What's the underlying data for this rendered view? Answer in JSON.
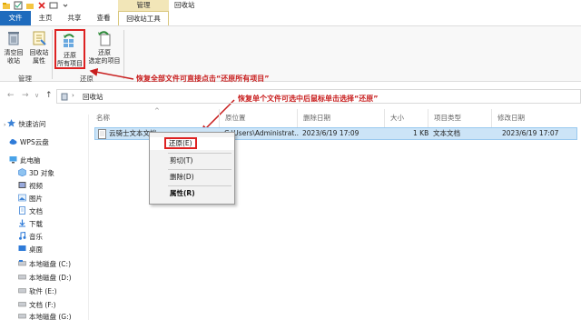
{
  "title_bar": {
    "context_tab_group": "管理",
    "window_title": "回收站"
  },
  "tabs": [
    {
      "label": "文件"
    },
    {
      "label": "主页"
    },
    {
      "label": "共享"
    },
    {
      "label": "查看"
    },
    {
      "label": "回收站工具"
    }
  ],
  "ribbon": {
    "empty_bin": "清空回收站",
    "empty_bin_l1": "清空回",
    "empty_bin_l2": "收站",
    "properties_l1": "回收站",
    "properties_l2": "属性",
    "restore_all_l1": "还原",
    "restore_all_l2": "所有项目",
    "restore_sel_l1": "还原",
    "restore_sel_l2": "选定的项目",
    "group_manage": "管理",
    "group_restore": "还原"
  },
  "annotations": {
    "restore_all_tip": "恢复全部文件可直接点击“还原所有项目”",
    "restore_single_tip": "恢复单个文件可选中后鼠标单击选择“还原”"
  },
  "address": {
    "path": "回收站"
  },
  "sidebar": {
    "items": [
      {
        "label": "快速访问",
        "icon": "star-icon"
      },
      {
        "label": "WPS云盘",
        "icon": "cloud-icon"
      },
      {
        "label": "此电脑",
        "icon": "computer-icon"
      },
      {
        "label": "3D 对象",
        "icon": "cube-icon"
      },
      {
        "label": "视频",
        "icon": "video-icon"
      },
      {
        "label": "图片",
        "icon": "picture-icon"
      },
      {
        "label": "文档",
        "icon": "document-icon"
      },
      {
        "label": "下载",
        "icon": "download-icon"
      },
      {
        "label": "音乐",
        "icon": "music-icon"
      },
      {
        "label": "桌面",
        "icon": "desktop-icon"
      },
      {
        "label": "本地磁盘 (C:)",
        "icon": "drive-icon"
      },
      {
        "label": "本地磁盘 (D:)",
        "icon": "drive-icon"
      },
      {
        "label": "软件 (E:)",
        "icon": "drive-icon"
      },
      {
        "label": "文档 (F:)",
        "icon": "drive-icon"
      },
      {
        "label": "本地磁盘 (G:)",
        "icon": "drive-icon"
      }
    ]
  },
  "columns": [
    "名称",
    "原位置",
    "删除日期",
    "大小",
    "项目类型",
    "修改日期"
  ],
  "files": [
    {
      "name": "云骑士文本文档",
      "location": "C:\\Users\\Administrat...",
      "deleted": "2023/6/19 17:09",
      "size": "1 KB",
      "type": "文本文档",
      "modified": "2023/6/19 17:07"
    }
  ],
  "context_menu": {
    "restore": "还原(E)",
    "cut": "剪切(T)",
    "delete": "删除(D)",
    "properties": "属性(R)"
  },
  "colors": {
    "accent": "#1e6bbd",
    "annotation": "#c81e1e",
    "selection": "#cce4f7",
    "context_tab": "#f2e6b8"
  }
}
